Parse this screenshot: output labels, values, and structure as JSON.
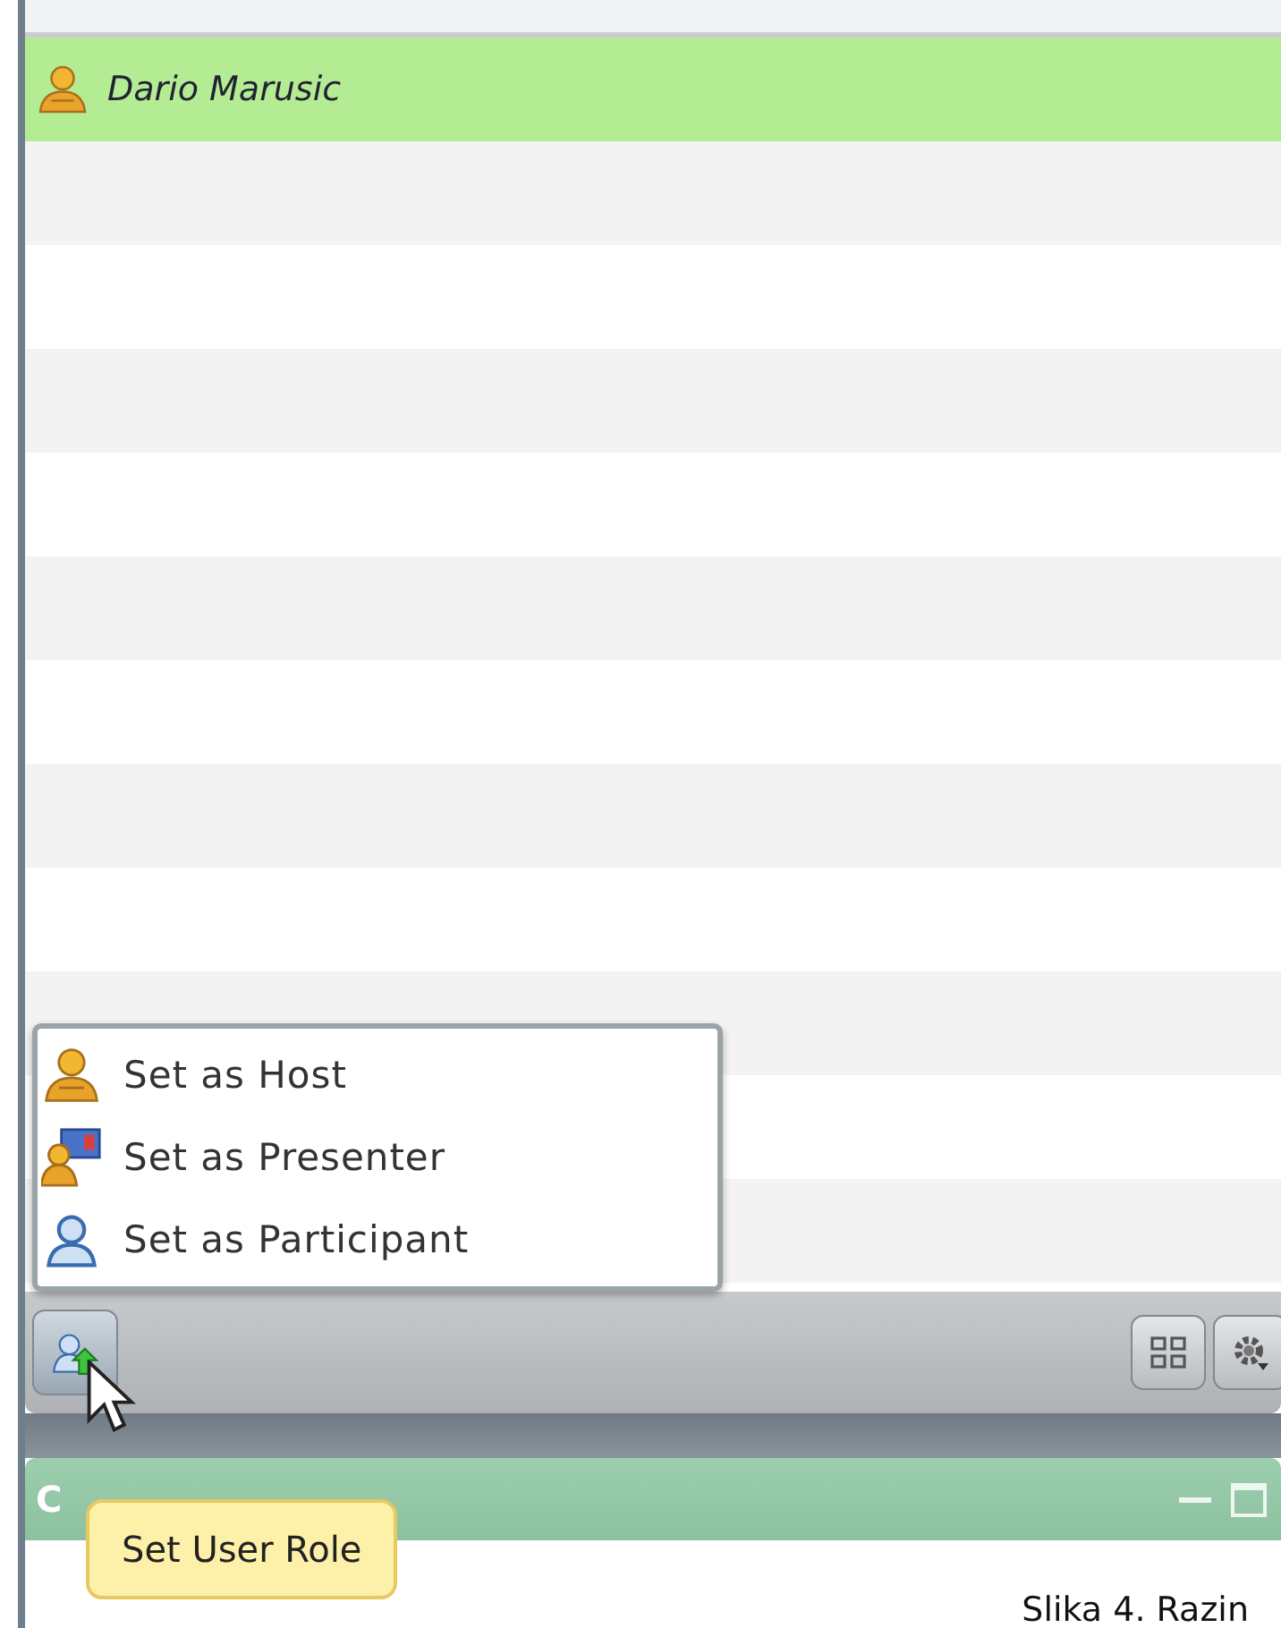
{
  "participants": [
    {
      "name": "Dario Marusic",
      "kind": "host",
      "selected": true
    }
  ],
  "role_menu": [
    {
      "label": "Set as Host",
      "kind": "host"
    },
    {
      "label": "Set as Presenter",
      "kind": "presenter"
    },
    {
      "label": "Set as Participant",
      "kind": "participant"
    }
  ],
  "tooltip": "Set User Role",
  "panel": {
    "title": "C"
  },
  "caption": "Slika 4. Razin"
}
